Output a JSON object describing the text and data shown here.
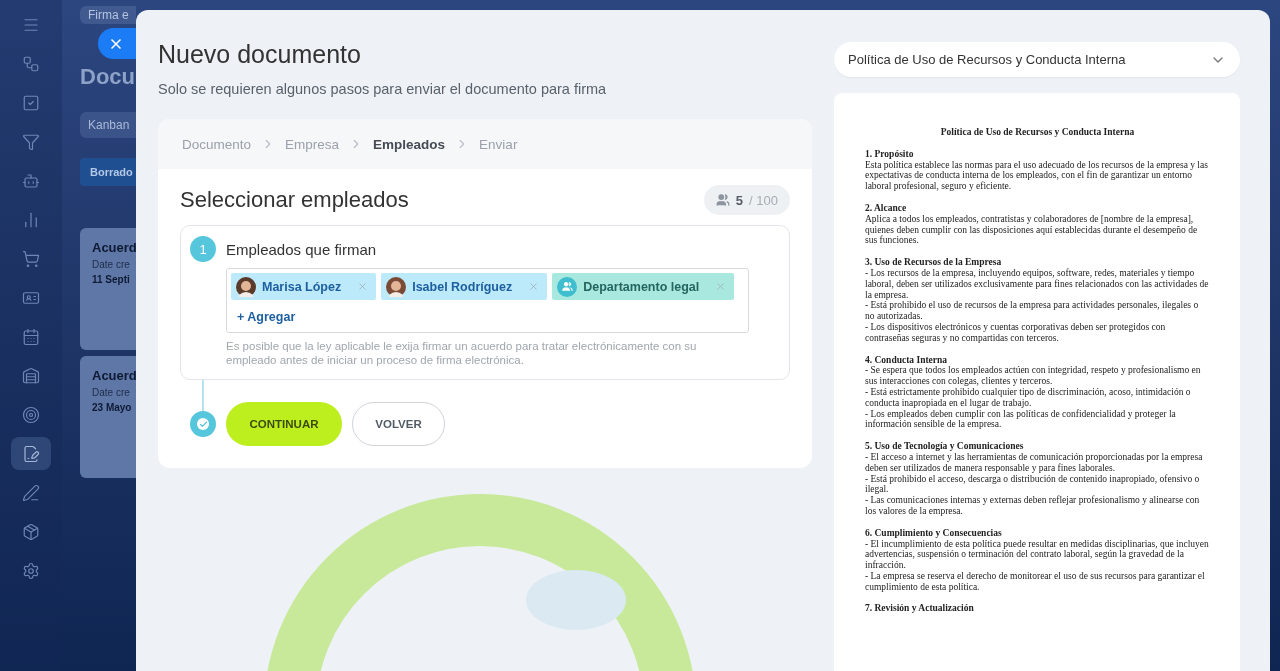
{
  "sidebar": {
    "items": [
      {
        "selected": false
      },
      {
        "selected": false
      },
      {
        "selected": false
      },
      {
        "selected": false
      },
      {
        "selected": false
      },
      {
        "selected": false
      },
      {
        "selected": false
      },
      {
        "selected": false
      },
      {
        "selected": false
      },
      {
        "selected": false
      },
      {
        "selected": false
      },
      {
        "selected": true
      },
      {
        "selected": false
      },
      {
        "selected": false
      },
      {
        "selected": false
      }
    ]
  },
  "backdrop": {
    "search_placeholder": "Firma e",
    "title": "Docu",
    "view": {
      "label": "Kanban",
      "selected": true
    },
    "column": "Borrado",
    "cards": [
      {
        "title": "Acuerd",
        "label": "Date cre",
        "date": "11 Septi"
      },
      {
        "title": "Acuerd",
        "label": "Date cre",
        "date": "23 Mayo"
      }
    ]
  },
  "panel": {
    "title": "Nuevo documento",
    "subtitle": "Solo se requieren algunos pasos para enviar el documento para firma",
    "breadcrumb": [
      {
        "label": "Documento",
        "selected": false
      },
      {
        "label": "Empresa",
        "selected": false
      },
      {
        "label": "Empleados",
        "selected": true
      },
      {
        "label": "Enviar",
        "selected": false
      }
    ],
    "section_title": "Seleccionar empleados",
    "counter": {
      "current": "5",
      "total": "/ 100"
    },
    "step": {
      "number": "1",
      "title": "Empleados que firman",
      "signers": [
        {
          "name": "Marisa López",
          "kind": "person"
        },
        {
          "name": "Isabel Rodríguez",
          "kind": "person"
        },
        {
          "name": "Departamento legal",
          "kind": "group"
        }
      ],
      "add": "+ Agregar",
      "hint": "Es posible que la ley aplicable le exija firmar un acuerdo para tratar electrónicamente con su empleado antes de iniciar un proceso de firma electrónica."
    },
    "buttons": [
      {
        "label": "CONTINUAR",
        "kind": "primary"
      },
      {
        "label": "VOLVER",
        "kind": "secondary"
      }
    ]
  },
  "preview": {
    "template": "Política de Uso de Recursos y Conducta Interna",
    "document": {
      "title": "Política de Uso de Recursos y Conducta Interna",
      "sections": [
        {
          "heading": "1. Propósito",
          "paragraphs": [
            "Esta política establece las normas para el uso adecuado de los recursos de la empresa y las expectativas de conducta interna de los empleados, con el fin de garantizar un entorno laboral profesional, seguro y eficiente."
          ]
        },
        {
          "heading": "2. Alcance",
          "paragraphs": [
            "Aplica a todos los empleados, contratistas y colaboradores de [nombre de la empresa], quienes deben cumplir con las disposiciones aquí establecidas durante el desempeño de sus funciones."
          ]
        },
        {
          "heading": "3. Uso de Recursos de la Empresa",
          "paragraphs": [
            "- Los recursos de la empresa, incluyendo equipos, software, redes, materiales y tiempo laboral, deben ser utilizados exclusivamente para fines relacionados con las actividades de la empresa.",
            "- Está prohibido el uso de recursos de la empresa para actividades personales, ilegales o no autorizadas.",
            "- Los dispositivos electrónicos y cuentas corporativas deben ser protegidos con contraseñas seguras y no compartidas con terceros."
          ]
        },
        {
          "heading": "4. Conducta Interna",
          "paragraphs": [
            "- Se espera que todos los empleados actúen con integridad, respeto y profesionalismo en sus interacciones con colegas, clientes y terceros.",
            "- Está estrictamente prohibido cualquier tipo de discriminación, acoso, intimidación o conducta inapropiada en el lugar de trabajo.",
            "- Los empleados deben cumplir con las políticas de confidencialidad y proteger la información sensible de la empresa."
          ]
        },
        {
          "heading": "5. Uso de Tecnología y Comunicaciones",
          "paragraphs": [
            "- El acceso a internet y las herramientas de comunicación proporcionadas por la empresa deben ser utilizados de manera responsable y para fines laborales.",
            "- Está prohibido el acceso, descarga o distribución de contenido inapropiado, ofensivo o ilegal.",
            "- Las comunicaciones internas y externas deben reflejar profesionalismo y alinearse con los valores de la empresa."
          ]
        },
        {
          "heading": "6. Cumplimiento y Consecuencias",
          "paragraphs": [
            "- El incumplimiento de esta política puede resultar en medidas disciplinarias, que incluyen advertencias, suspensión o terminación del contrato laboral, según la gravedad de la infracción.",
            "- La empresa se reserva el derecho de monitorear el uso de sus recursos para garantizar el cumplimiento de esta política."
          ]
        },
        {
          "heading": "7. Revisión y Actualización"
        }
      ]
    }
  }
}
